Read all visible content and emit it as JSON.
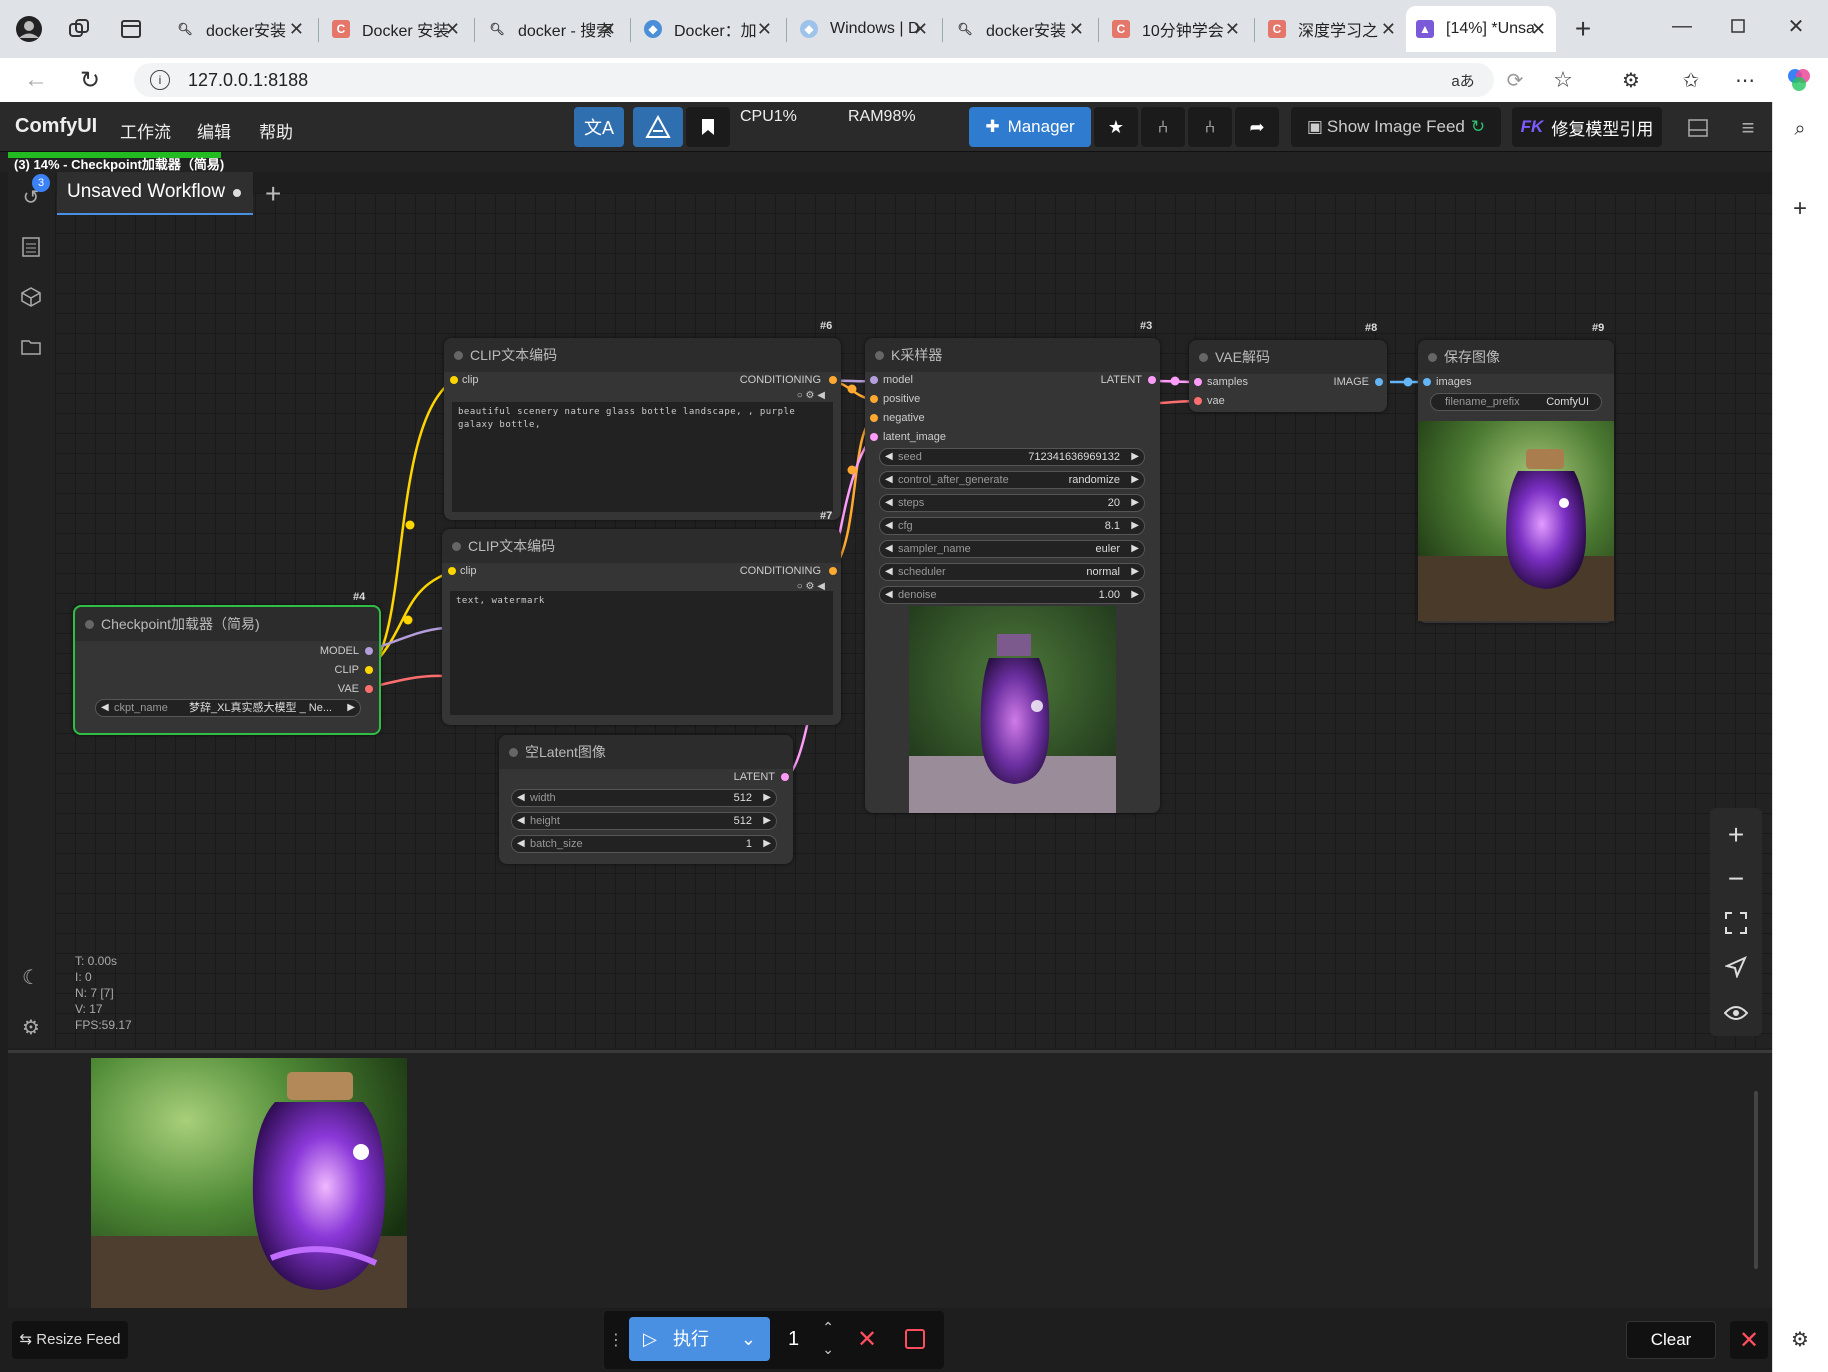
{
  "browser": {
    "tabs": [
      {
        "label": "docker安装",
        "favicon": "search"
      },
      {
        "label": "Docker 安装",
        "favicon": "c"
      },
      {
        "label": "docker - 搜索",
        "favicon": "search"
      },
      {
        "label": "Docker：加",
        "favicon": "docker"
      },
      {
        "label": "Windows | D",
        "favicon": "docker"
      },
      {
        "label": "docker安装",
        "favicon": "search"
      },
      {
        "label": "10分钟学会",
        "favicon": "c"
      },
      {
        "label": "深度学习之",
        "favicon": "c"
      },
      {
        "label": "[14%] *Unsa",
        "favicon": "comfy"
      }
    ],
    "url": "127.0.0.1:8188"
  },
  "menu": {
    "logo": "ComfyUI",
    "items": [
      "工作流",
      "编辑",
      "帮助"
    ],
    "cpu": "CPU1%",
    "ram": "RAM98%",
    "manager": "Manager",
    "image_feed": "Show Image Feed",
    "fix_models": "修复模型引用",
    "fk": "FK"
  },
  "progress": {
    "text": "(3) 14% - Checkpoint加载器（简易)",
    "percent": 14
  },
  "sidebar": {
    "queue_badge": "3"
  },
  "workflow_tab": {
    "label": "Unsaved Workflow"
  },
  "nodes": {
    "clip_pos": {
      "id": "#6",
      "title": "CLIP文本编码",
      "input": "clip",
      "output": "CONDITIONING",
      "text": "beautiful scenery nature glass bottle landscape, , purple galaxy bottle,"
    },
    "clip_neg": {
      "id": "#7",
      "title": "CLIP文本编码",
      "input": "clip",
      "output": "CONDITIONING",
      "text": "text, watermark"
    },
    "checkpoint": {
      "id": "#4",
      "title": "Checkpoint加载器（简易)",
      "outputs": [
        "MODEL",
        "CLIP",
        "VAE"
      ],
      "ckpt_label": "ckpt_name",
      "ckpt_value": "梦辞_XL真实感大模型 _ Ne..."
    },
    "ksampler": {
      "id": "#3",
      "title": "K采样器",
      "inputs": [
        "model",
        "positive",
        "negative",
        "latent_image"
      ],
      "output": "LATENT",
      "widgets": [
        {
          "label": "seed",
          "value": "712341636969132"
        },
        {
          "label": "control_after_generate",
          "value": "randomize"
        },
        {
          "label": "steps",
          "value": "20"
        },
        {
          "label": "cfg",
          "value": "8.1"
        },
        {
          "label": "sampler_name",
          "value": "euler"
        },
        {
          "label": "scheduler",
          "value": "normal"
        },
        {
          "label": "denoise",
          "value": "1.00"
        }
      ]
    },
    "latent": {
      "id": "#5",
      "title": "空Latent图像",
      "output": "LATENT",
      "widgets": [
        {
          "label": "width",
          "value": "512"
        },
        {
          "label": "height",
          "value": "512"
        },
        {
          "label": "batch_size",
          "value": "1"
        }
      ]
    },
    "vae": {
      "id": "#8",
      "title": "VAE解码",
      "inputs": [
        "samples",
        "vae"
      ],
      "output": "IMAGE"
    },
    "save": {
      "id": "#9",
      "title": "保存图像",
      "input": "images",
      "prefix_label": "filename_prefix",
      "prefix_value": "ComfyUI"
    }
  },
  "stats": {
    "t": "T: 0.00s",
    "i": "I: 0",
    "n": "N: 7 [7]",
    "v": "V: 17",
    "fps": "FPS:59.17"
  },
  "bottom": {
    "resize_feed": "Resize Feed",
    "run": "执行",
    "batch_count": "1",
    "clear": "Clear"
  },
  "colors": {
    "accent": "#2f7bd0",
    "clip_link": "#ffd500",
    "model_link": "#b39ddb",
    "vae_link": "#ff6e6e",
    "conditioning_link": "#ffa931",
    "latent_link": "#ff9cf9",
    "image_link": "#64b5f6",
    "progress": "#22bb22"
  }
}
